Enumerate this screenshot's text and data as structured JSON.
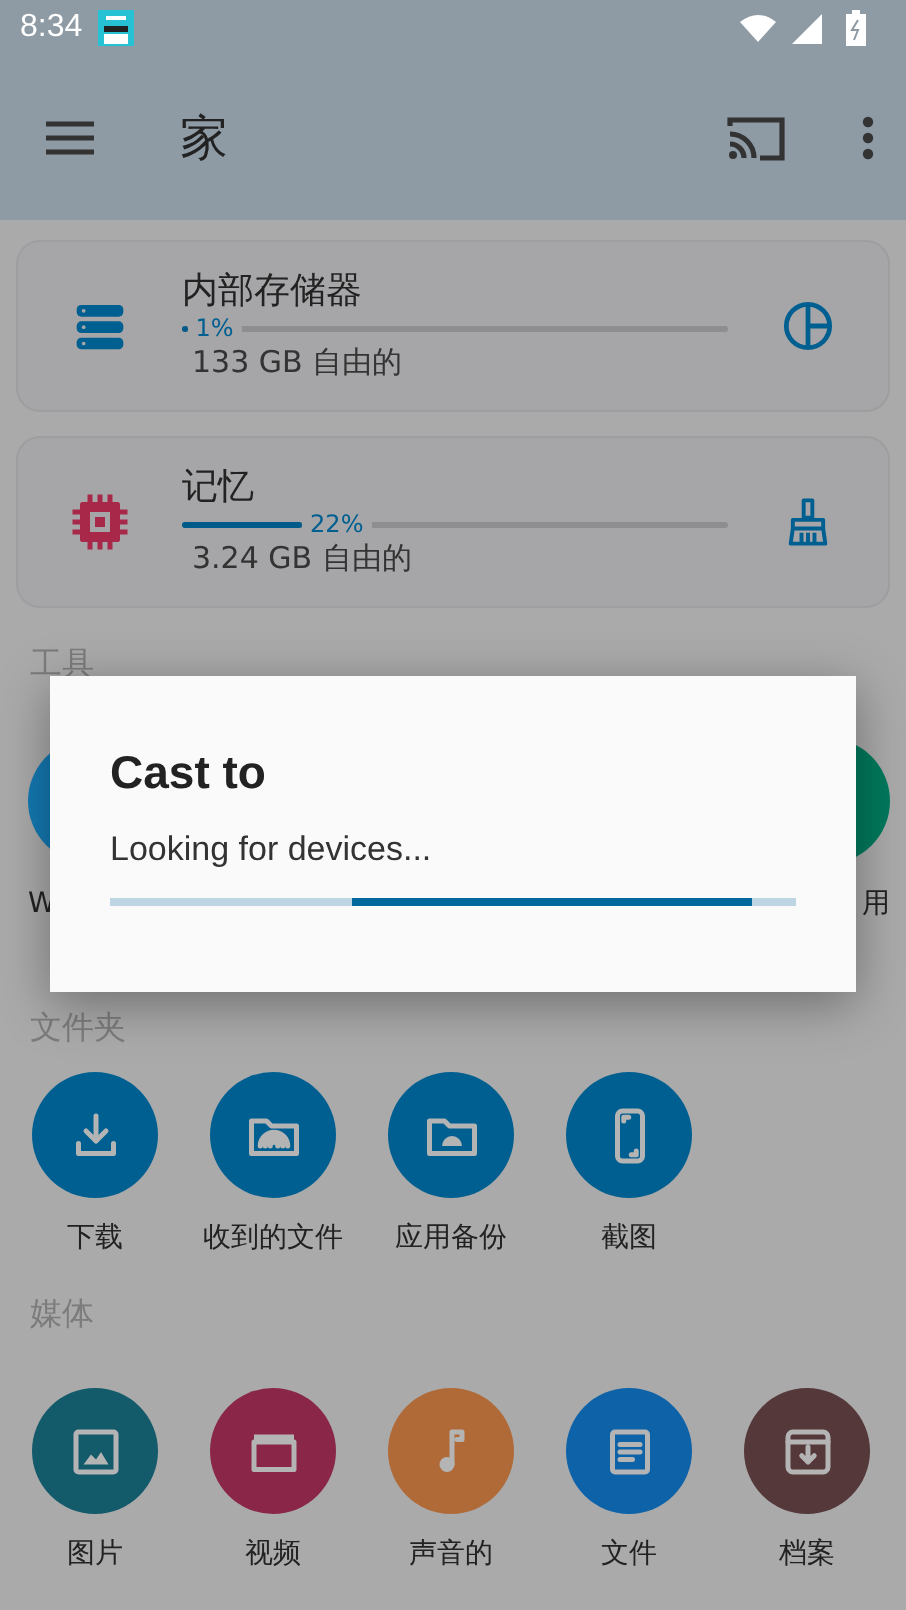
{
  "status_bar": {
    "time": "8:34"
  },
  "app_bar": {
    "title": "家"
  },
  "storage": [
    {
      "kind": "storage",
      "name": "内部存储器",
      "level": 0.01,
      "reading": "1%",
      "free": "133 GB 自由的"
    },
    {
      "kind": "memory",
      "name": "记忆",
      "level": 0.22,
      "reading": "22%",
      "free": "3.24 GB 自由的"
    }
  ],
  "sections": [
    {
      "title": "工具",
      "items": [
        {
          "label": "W",
          "color": "#1479b2"
        },
        {
          "label": "用",
          "color": "#00795c"
        }
      ]
    },
    {
      "title": "文件夹",
      "items": [
        {
          "kind": "download",
          "label": "下载",
          "color": "#005f91"
        },
        {
          "kind": "received",
          "label": "收到的文件",
          "color": "#005f91"
        },
        {
          "kind": "backup",
          "label": "应用备份",
          "color": "#005f91"
        },
        {
          "kind": "screenshot",
          "label": "截图",
          "color": "#005f91"
        }
      ]
    },
    {
      "title": "媒体",
      "items": [
        {
          "kind": "image",
          "label": "图片",
          "color": "#135a6a"
        },
        {
          "kind": "video",
          "label": "视频",
          "color": "#8a2748"
        },
        {
          "kind": "audio",
          "label": "声音的",
          "color": "#b06a38"
        },
        {
          "kind": "document",
          "label": "文件",
          "color": "#0d62a8"
        },
        {
          "kind": "archive",
          "label": "档案",
          "color": "#54383a"
        }
      ]
    }
  ],
  "dialog": {
    "title": "Cast to",
    "message": "Looking for devices...",
    "indeterminate": true
  }
}
